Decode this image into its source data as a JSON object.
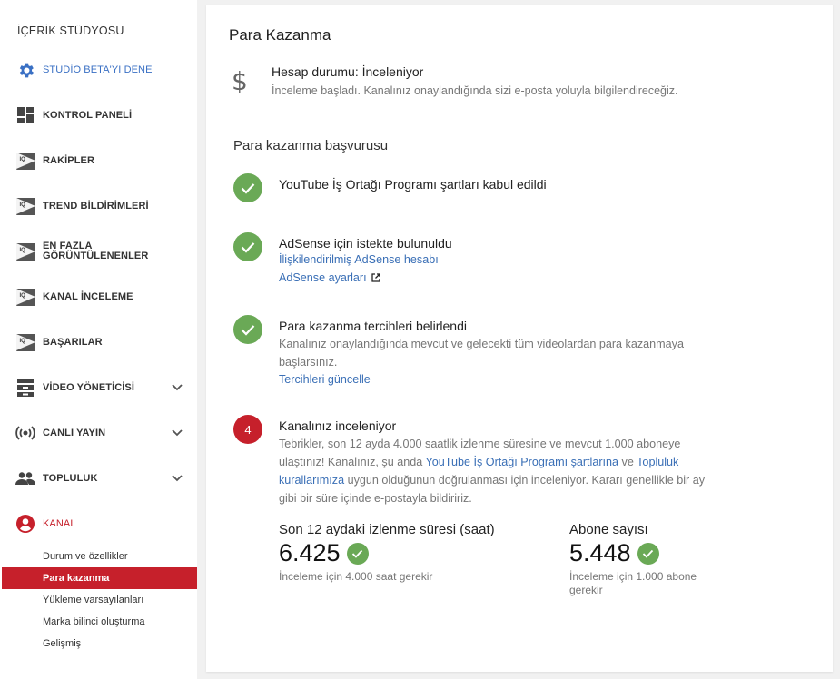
{
  "sidebar": {
    "title": "İÇERİK STÜDYOSU",
    "items": [
      {
        "label": "STUDİO BETA'YI DENE",
        "icon": "gear-icon"
      },
      {
        "label": "KONTROL PANELİ",
        "icon": "dashboard-icon"
      },
      {
        "label": "RAKİPLER",
        "icon": "iq-icon"
      },
      {
        "label": "TREND BİLDİRİMLERİ",
        "icon": "iq-icon"
      },
      {
        "label_line1": "EN FAZLA",
        "label_line2": "GÖRÜNTÜLENENLER",
        "icon": "iq-icon"
      },
      {
        "label": "KANAL İNCELEME",
        "icon": "iq-icon"
      },
      {
        "label": "BAŞARILAR",
        "icon": "iq-icon"
      },
      {
        "label": "VİDEO YÖNETİCİSİ",
        "icon": "video-manager-icon"
      },
      {
        "label": "CANLI YAYIN",
        "icon": "live-broadcast-icon"
      },
      {
        "label": "TOPLULUK",
        "icon": "community-icon"
      },
      {
        "label": "KANAL",
        "icon": "account-circle-icon"
      }
    ],
    "sub_items": [
      {
        "label": "Durum ve özellikler"
      },
      {
        "label": "Para kazanma"
      },
      {
        "label": "Yükleme varsayılanları"
      },
      {
        "label": "Marka bilinci oluşturma"
      },
      {
        "label": "Gelişmiş"
      }
    ]
  },
  "main": {
    "title": "Para Kazanma",
    "account_status": "Hesap durumu: İnceleniyor",
    "account_desc": "İnceleme başladı. Kanalınız onaylandığında sizi e-posta yoluyla bilgilendireceğiz.",
    "section_title": "Para kazanma başvurusu",
    "steps": [
      {
        "title": "YouTube İş Ortağı Programı şartları kabul edildi"
      },
      {
        "title": "AdSense için istekte bulunuldu",
        "link1": "İlişkilendirilmiş AdSense hesabı",
        "link2": "AdSense ayarları"
      },
      {
        "title": "Para kazanma tercihleri belirlendi",
        "text": "Kanalınız onaylandığında mevcut ve gelecekti tüm videolardan para kazanmaya başlarsınız.",
        "link": "Tercihleri güncelle"
      },
      {
        "number": "4",
        "title": "Kanalınız inceleniyor",
        "text1": "Tebrikler, son 12 ayda 4.000 saatlik izlenme süresine ve mevcut 1.000 aboneye ulaştınız! Kanalınız, şu anda ",
        "link_a": "YouTube İş Ortağı Programı şartlarına",
        "text2": " ve ",
        "link_b": "Topluluk kurallarımıza",
        "text3": " uygun olduğunun doğrulanması için inceleniyor. Kararı genellikle bir ay gibi bir süre içinde e-postayla bildiririz."
      }
    ],
    "metrics": [
      {
        "label": "Son 12 aydaki izlenme süresi (saat)",
        "value": "6.425",
        "note": "İnceleme için 4.000 saat gerekir"
      },
      {
        "label": "Abone sayısı",
        "value": "5.448",
        "note": "İnceleme için 1.000 abone gerekir"
      }
    ]
  }
}
